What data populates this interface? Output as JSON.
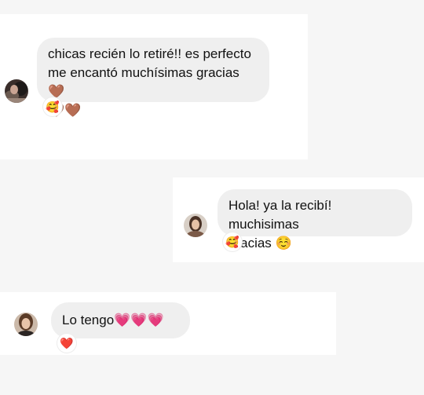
{
  "messages": [
    {
      "sender": "other",
      "text": "chicas recién lo retiré!! es perfecto\nme encantó muchísimas gracias 🤎\n🤎🤎",
      "reaction": "🥰"
    },
    {
      "sender": "other",
      "text": "Hola! ya la recibí! muchisimas\ngracias ☺️",
      "reaction": "🥰"
    },
    {
      "sender": "other",
      "text": "Lo tengo💗💗💗",
      "reaction": "❤️"
    }
  ],
  "colors": {
    "bubble": "#efefef",
    "text": "#111111",
    "background": "#ffffff"
  }
}
